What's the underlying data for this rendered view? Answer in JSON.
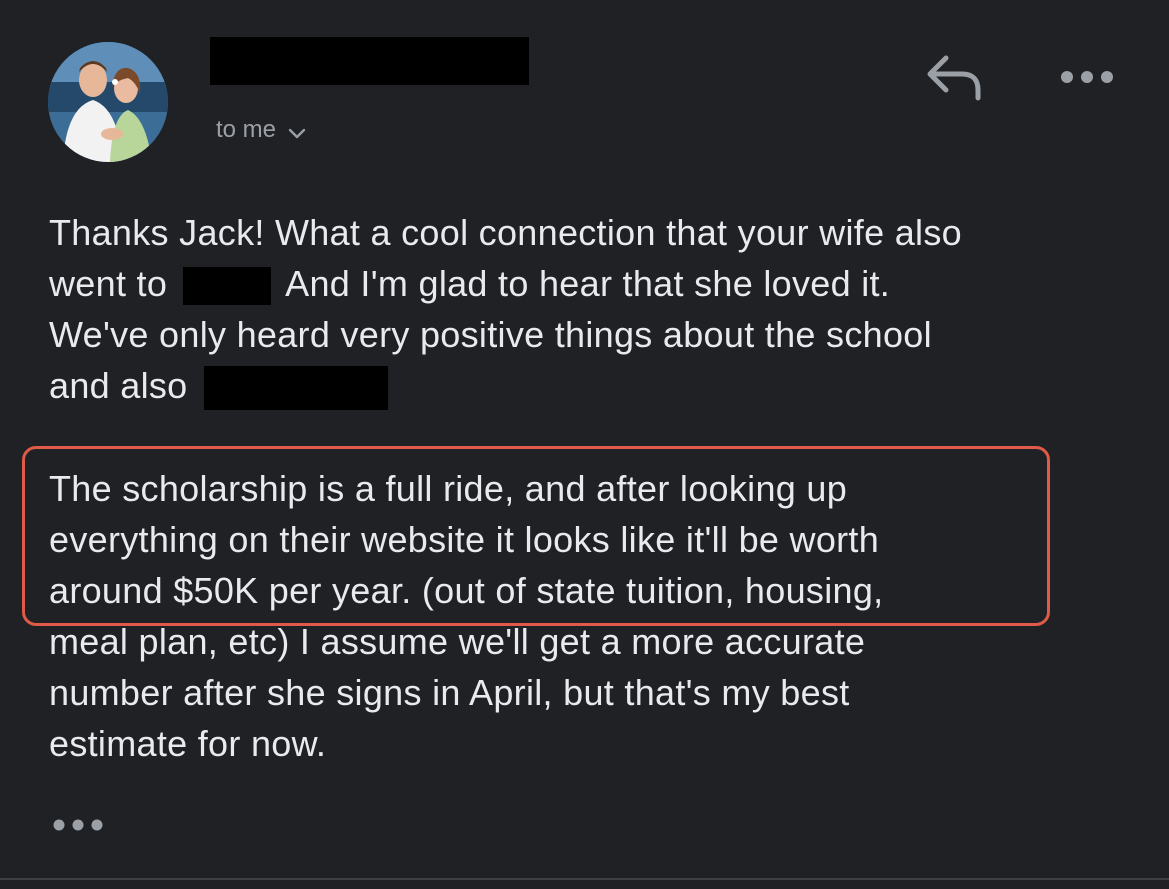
{
  "header": {
    "recipient_label": "to me",
    "icons": {
      "avatar": "profile-photo",
      "reply": "reply-arrow-icon",
      "more": "more-options-icon",
      "recipient_toggle": "chevron-down-icon"
    }
  },
  "message": {
    "paragraph1": {
      "line1": "Thanks Jack! What a cool connection that your wife also",
      "line2_before": "went to",
      "line2_after": "And I'm glad to hear that she loved it.",
      "line3": "We've only heard very positive things about the school",
      "line4_before": "and also"
    },
    "paragraph2": {
      "line1": "The scholarship is a full ride, and after looking up",
      "line2": "everything on their website it looks like it'll be worth",
      "line3": "around $50K per year.  (out of state tuition, housing,",
      "line4": "meal plan, etc) I assume we'll get a more accurate",
      "line5": "number after she signs in April, but that's my best",
      "line6": "estimate for now."
    }
  },
  "colors": {
    "background": "#202124",
    "text": "#e8eaed",
    "secondary_text": "#9aa0a6",
    "highlight_border": "#e05a4a"
  }
}
